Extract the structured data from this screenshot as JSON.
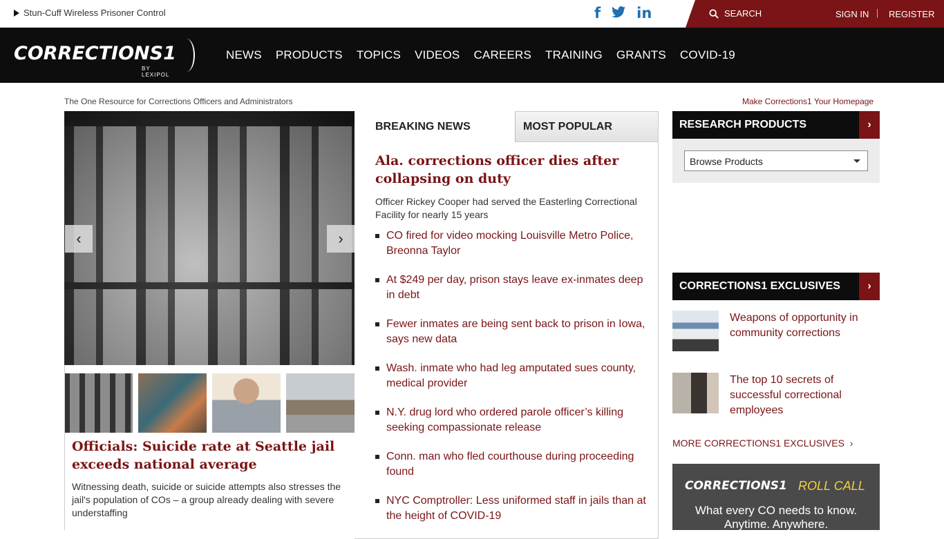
{
  "topbar": {
    "promo_text": "Stun-Cuff Wireless Prisoner Control",
    "social_icons": [
      "facebook-icon",
      "twitter-icon",
      "linkedin-icon"
    ],
    "search_label": "SEARCH",
    "sign_in": "SIGN IN",
    "register": "REGISTER",
    "accent_color": "#7a1416"
  },
  "nav": {
    "logo_text": "CORRECTIONS1",
    "logo_byline": "BY LEXIPOL",
    "items": [
      "NEWS",
      "PRODUCTS",
      "TOPICS",
      "VIDEOS",
      "CAREERS",
      "TRAINING",
      "GRANTS",
      "COVID-19"
    ]
  },
  "tagline": "The One Resource for Corrections Officers and Administrators",
  "homepage_link": "Make Corrections1 Your Homepage",
  "slideshow": {
    "prev_icon": "chevron-left-icon",
    "next_icon": "chevron-right-icon",
    "headline": "Officials: Suicide rate at Seattle jail exceeds national average",
    "dek": "Witnessing death, suicide or suicide attempts also stresses the jail's population of COs – a group already dealing with severe understaffing"
  },
  "news_panel": {
    "tabs": [
      "BREAKING NEWS",
      "MOST POPULAR"
    ],
    "main_headline": "Ala. corrections officer dies after collapsing on duty",
    "main_dek": "Officer Rickey Cooper had served the Easterling Correctional Facility for nearly 15 years",
    "items": [
      "CO fired for video mocking Louisville Metro Police, Breonna Taylor",
      "At $249 per day, prison stays leave ex-inmates deep in debt",
      "Fewer inmates are being sent back to prison in Iowa, says new data",
      "Wash. inmate who had leg amputated sues county, medical provider",
      "N.Y. drug lord who ordered parole officer’s killing seeking compassionate release",
      "Conn. man who fled courthouse during proceeding found",
      "NYC Comptroller: Less uniformed staff in jails than at the height of COVID-19"
    ]
  },
  "research_products": {
    "title": "RESEARCH PRODUCTS",
    "select_value": "Browse Products"
  },
  "exclusives": {
    "title": "CORRECTIONS1 EXCLUSIVES",
    "items": [
      "Weapons of opportunity in community corrections",
      "The top 10 secrets of successful correctional employees"
    ],
    "more_link": "MORE CORRECTIONS1 EXCLUSIVES"
  },
  "rollcall": {
    "logo": "CORRECTIONS1",
    "word": "ROLL CALL",
    "line1": "What every CO needs to know.",
    "line2": "Anytime. Anywhere."
  }
}
